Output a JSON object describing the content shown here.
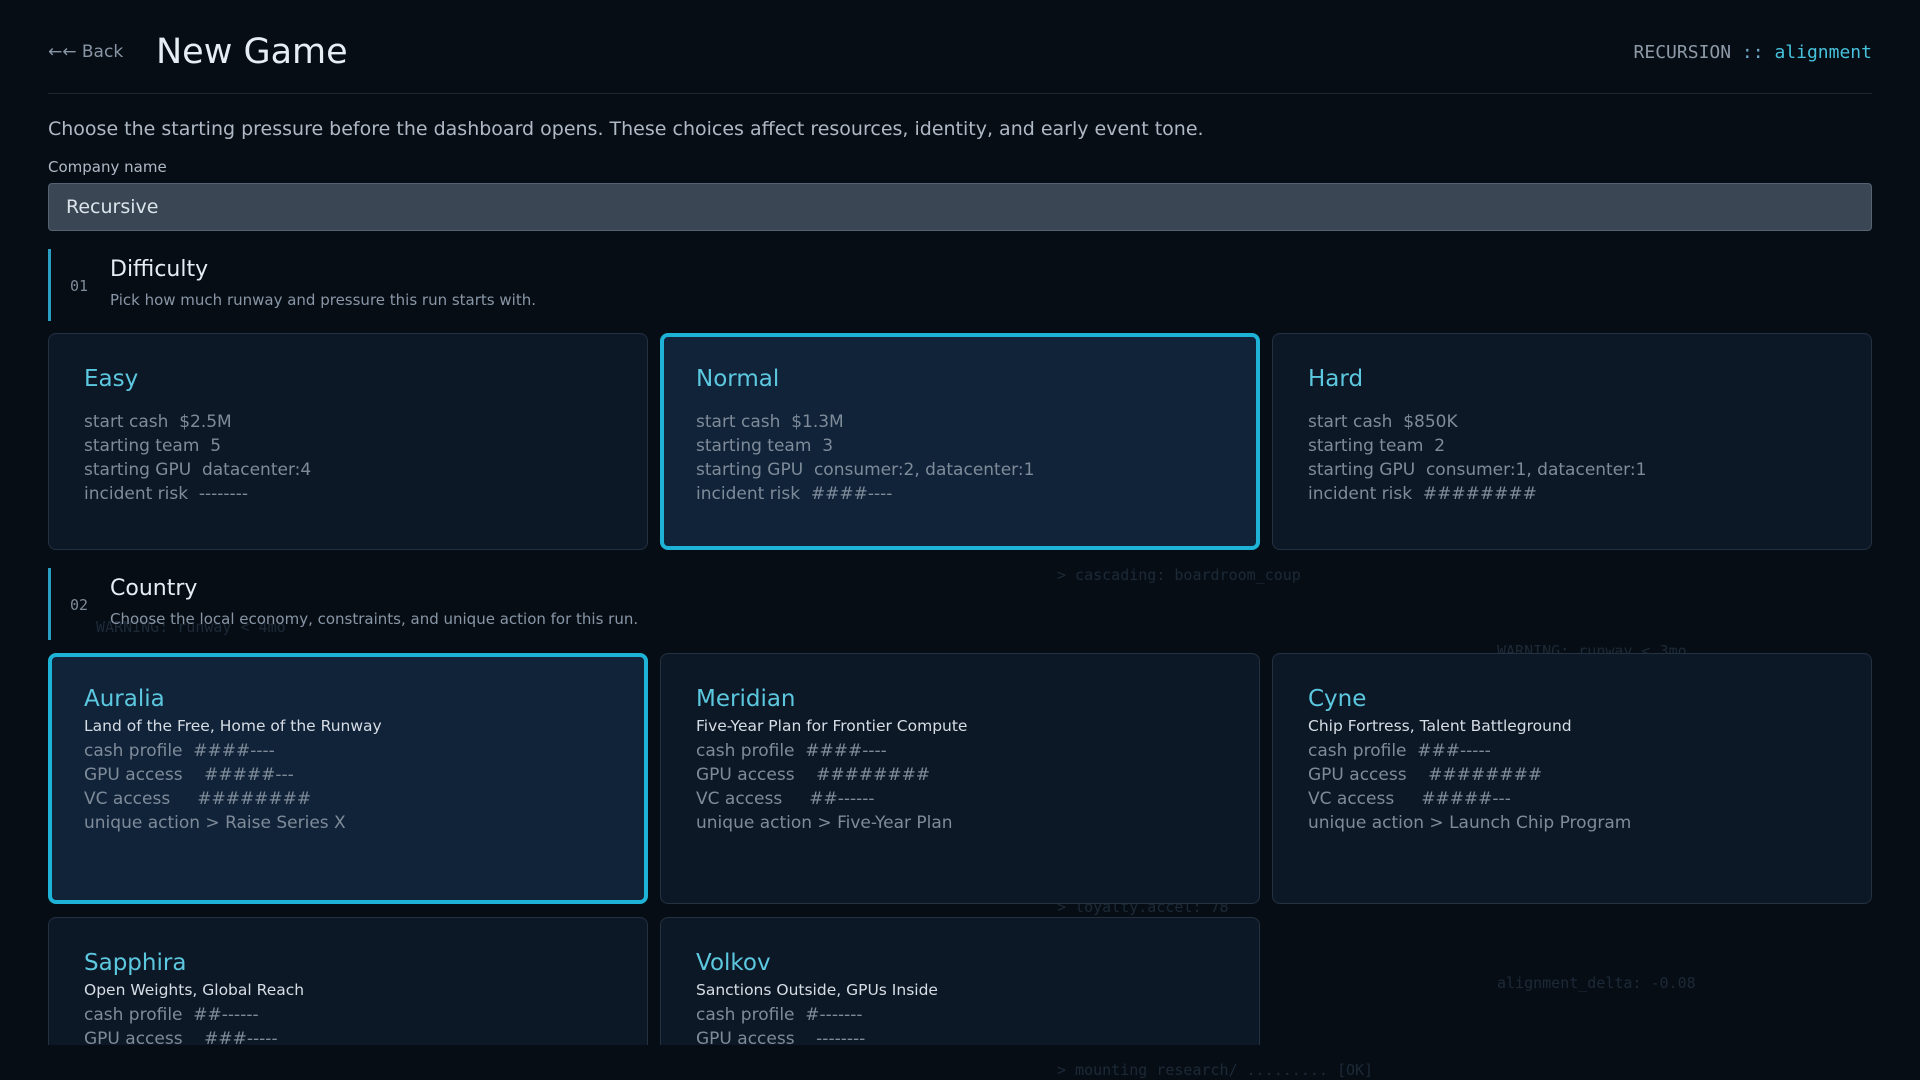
{
  "header": {
    "back_label": "←← Back",
    "title": "New Game",
    "brand_prefix": "RECURSION",
    "brand_sep": " :: ",
    "brand_suffix": "alignment"
  },
  "intro": "Choose the starting pressure before the dashboard opens. These choices affect resources, identity, and early event tone.",
  "company": {
    "label": "Company name",
    "value": "Recursive"
  },
  "difficulty": {
    "num": "01",
    "title": "Difficulty",
    "desc": "Pick how much runway and pressure this run starts with.",
    "selected": "Normal",
    "options": [
      {
        "name": "Easy",
        "rows": [
          "start cash  $2.5M",
          "starting team  5",
          "starting GPU  datacenter:4",
          "incident risk  --------"
        ]
      },
      {
        "name": "Normal",
        "rows": [
          "start cash  $1.3M",
          "starting team  3",
          "starting GPU  consumer:2, datacenter:1",
          "incident risk  ####----"
        ]
      },
      {
        "name": "Hard",
        "rows": [
          "start cash  $850K",
          "starting team  2",
          "starting GPU  consumer:1, datacenter:1",
          "incident risk  ########"
        ]
      }
    ]
  },
  "country": {
    "num": "02",
    "title": "Country",
    "desc": "Choose the local economy, constraints, and unique action for this run.",
    "selected": "Auralia",
    "options": [
      {
        "name": "Auralia",
        "tagline": "Land of the Free, Home of the Runway",
        "rows": [
          "cash profile  ####----",
          "GPU access    #####---",
          "VC access     ########",
          "unique action > Raise Series X"
        ]
      },
      {
        "name": "Meridian",
        "tagline": "Five-Year Plan for Frontier Compute",
        "rows": [
          "cash profile  ####----",
          "GPU access    ########",
          "VC access     ##------",
          "unique action > Five-Year Plan"
        ]
      },
      {
        "name": "Cyne",
        "tagline": "Chip Fortress, Talent Battleground",
        "rows": [
          "cash profile  ###-----",
          "GPU access    ########",
          "VC access     #####---",
          "unique action > Launch Chip Program"
        ]
      },
      {
        "name": "Sapphira",
        "tagline": "Open Weights, Global Reach",
        "rows": [
          "cash profile  ##------",
          "GPU access    ###-----"
        ]
      },
      {
        "name": "Volkov",
        "tagline": "Sanctions Outside, GPUs Inside",
        "rows": [
          "cash profile  #-------",
          "GPU access    --------"
        ]
      }
    ]
  },
  "background_log": [
    "> cascading: boardroom_coup",
    "WARNING: runway < 4mo",
    "WARNING: runway < 3mo",
    "> loyalty.accel: 78",
    "alignment_delta: -0.08",
    "> mounting research/ ......... [OK]"
  ]
}
